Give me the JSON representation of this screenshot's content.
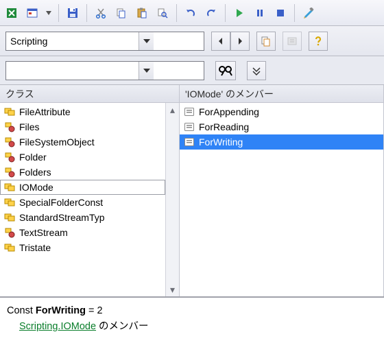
{
  "toolbar": {
    "icons": [
      "excel",
      "form-view",
      "dropdown-mini",
      "save",
      "cut",
      "copy",
      "paste",
      "find",
      "undo",
      "redo",
      "run",
      "pause",
      "stop",
      "design"
    ]
  },
  "nav": {
    "library_value": "Scripting",
    "back_label": "◀",
    "fwd_label": "▶"
  },
  "search": {
    "value": ""
  },
  "classes": {
    "header": "クラス",
    "items": [
      {
        "label": "FileAttribute",
        "icon": "enum"
      },
      {
        "label": "Files",
        "icon": "class"
      },
      {
        "label": "FileSystemObject",
        "icon": "class"
      },
      {
        "label": "Folder",
        "icon": "class"
      },
      {
        "label": "Folders",
        "icon": "class"
      },
      {
        "label": "IOMode",
        "icon": "enum",
        "selected": true
      },
      {
        "label": "SpecialFolderConst",
        "icon": "enum"
      },
      {
        "label": "StandardStreamTyp",
        "icon": "enum"
      },
      {
        "label": "TextStream",
        "icon": "class"
      },
      {
        "label": "Tristate",
        "icon": "enum"
      }
    ]
  },
  "members": {
    "header": "'IOMode' のメンバー",
    "items": [
      {
        "label": "ForAppending"
      },
      {
        "label": "ForReading"
      },
      {
        "label": "ForWriting",
        "selected": true
      }
    ]
  },
  "detail": {
    "const_kw": "Const",
    "const_name": "ForWriting",
    "const_eq": "= 2",
    "link_text": "Scripting.IOMode",
    "tail": " のメンバー"
  }
}
